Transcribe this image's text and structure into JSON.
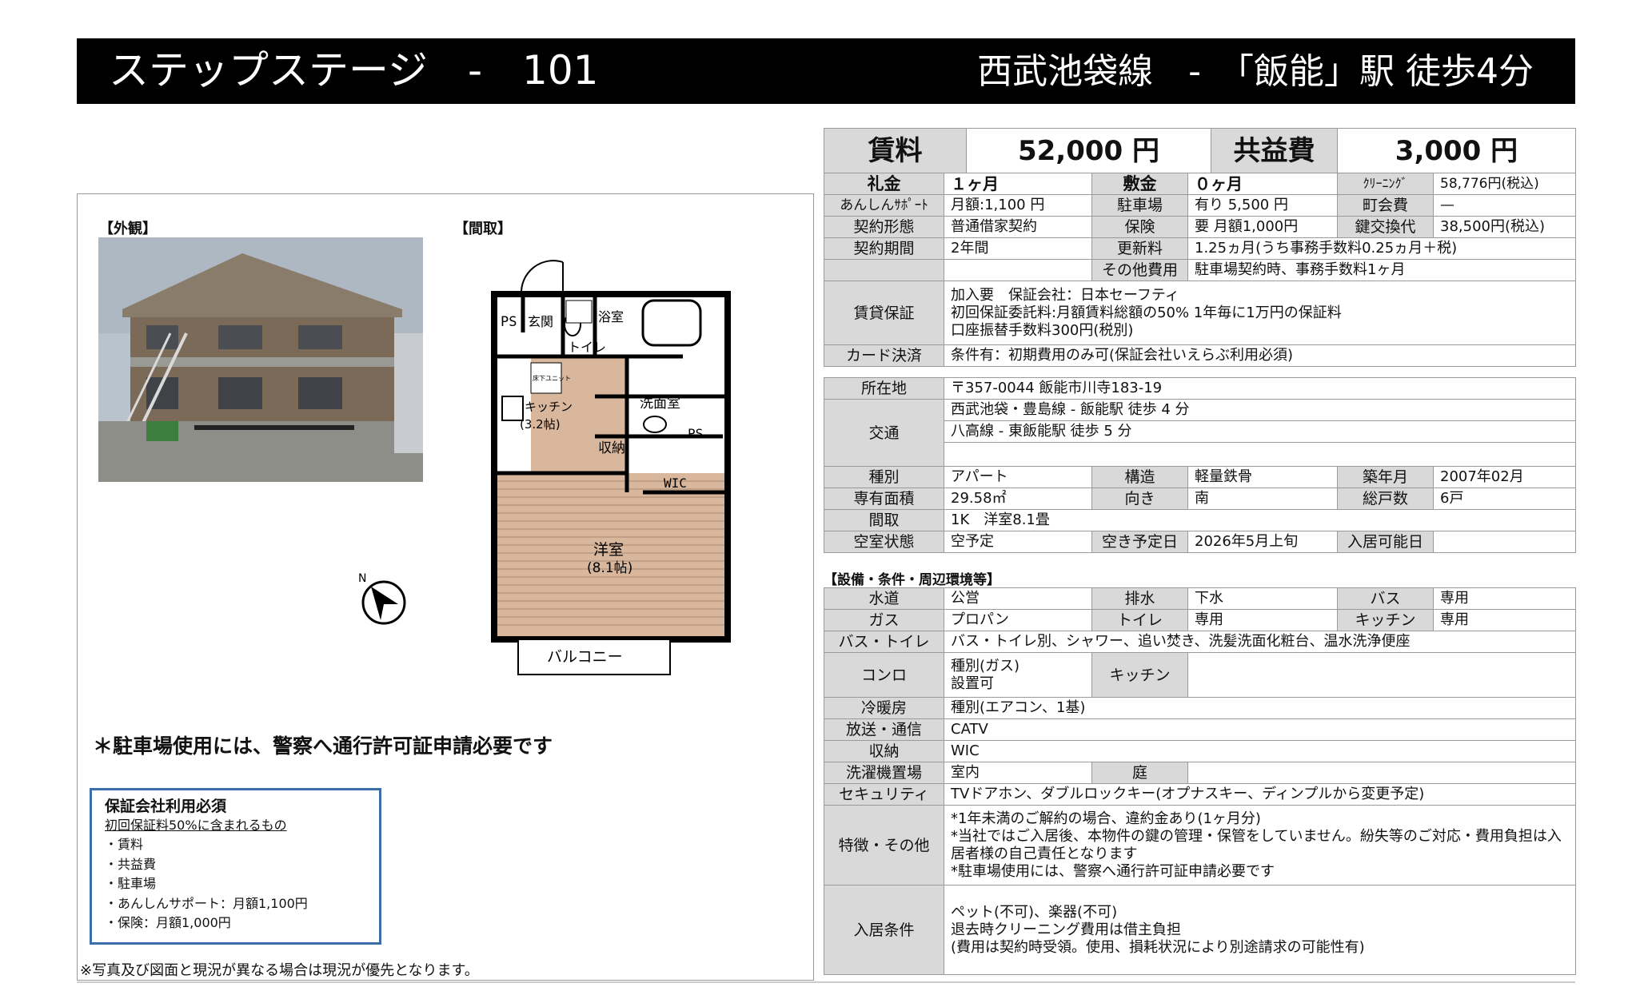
{
  "header": {
    "property": "ステップステージ　-　101",
    "station": "西武池袋線　-　「飯能」駅 徒歩4分"
  },
  "photos": {
    "exterior_label": "【外観】",
    "floorplan_label": "【間取】"
  },
  "floorplan": {
    "ps1": "PS",
    "genkan": "玄関",
    "toilet": "トイレ",
    "bath": "浴室",
    "unit": "床下ユニット",
    "kitchen": "キッチン",
    "kitchen_size": "(3.2帖)",
    "storage": "収納",
    "washroom": "洗面室",
    "ps2": "PS",
    "wic": "WIC",
    "room": "洋室",
    "room_size": "(8.1帖)",
    "balcony": "バルコニー"
  },
  "compass_label": "N",
  "parking_note": "＊駐車場使用には、警察へ通行許可証申請必要です",
  "guarantee_box": {
    "title": "保証会社利用必須",
    "subtitle": "初回保証料50%に含まれるもの",
    "items": [
      "・賃料",
      "・共益費",
      "・駐車場",
      "・あんしんサポート：月額1,100円",
      "・保険：月額1,000円"
    ]
  },
  "footer_note": "※写真及び図面と現況が異なる場合は現況が優先となります。",
  "rent": {
    "rent_label": "賃料",
    "rent": "52,000 円",
    "fee_label": "共益費",
    "fee": "3,000 円"
  },
  "terms": {
    "reikin_l": "礼金",
    "reikin": "１ヶ月",
    "shikikin_l": "敷金",
    "shikikin": "０ヶ月",
    "cleaning_l": "ｸﾘｰﾆﾝｸﾞ",
    "cleaning": "58,776円(税込)",
    "anshin_l": "あんしんｻﾎﾟｰﾄ",
    "anshin": "月額:1,100 円",
    "parking_l": "駐車場",
    "parking": "有り 5,500 円",
    "chokai_l": "町会費",
    "chokai": "—",
    "contract_l": "契約形態",
    "contract": "普通借家契約",
    "insurance_l": "保険",
    "insurance": "要 月額1,000円",
    "key_l": "鍵交換代",
    "key": "38,500円(税込)",
    "period_l": "契約期間",
    "period": "2年間",
    "renew_l": "更新料",
    "renew": "1.25ヵ月(うち事務手数料0.25ヵ月＋税)",
    "other_l": "その他費用",
    "other": "駐車場契約時、事務手数料1ヶ月",
    "guar_l": "賃貸保証",
    "guar1": "加入要　保証会社：日本セーフティ",
    "guar2": "初回保証委託料:月額賃料総額の50% 1年毎に1万円の保証料",
    "guar3": "口座振替手数料300円(税別)",
    "card_l": "カード決済",
    "card": "条件有：初期費用のみ可(保証会社いえらぶ利用必須)"
  },
  "info": {
    "addr_l": "所在地",
    "addr": "〒357-0044 飯能市川寺183-19",
    "access_l": "交通",
    "access1": "西武池袋・豊島線 - 飯能駅 徒歩 4 分",
    "access2": "八高線 - 東飯能駅 徒歩 5 分",
    "type_l": "種別",
    "type": "アパート",
    "struct_l": "構造",
    "struct": "軽量鉄骨",
    "built_l": "築年月",
    "built": "2007年02月",
    "area_l": "専有面積",
    "area": "29.58㎡",
    "dir_l": "向き",
    "dir": "南",
    "units_l": "総戸数",
    "units": "6戸",
    "layout_l": "間取",
    "layout": "1K　洋室8.1畳",
    "status_l": "空室状態",
    "status": "空予定",
    "avail_l": "空き予定日",
    "avail": "2026年5月上旬",
    "move_l": "入居可能日",
    "move": ""
  },
  "facilities_title": "【設備・条件・周辺環境等】",
  "facilities": {
    "water_l": "水道",
    "water": "公営",
    "drain_l": "排水",
    "drain": "下水",
    "bath_l": "バス",
    "bath": "専用",
    "gas_l": "ガス",
    "gas": "プロパン",
    "toilet_l": "トイレ",
    "toilet": "専用",
    "kitchen_l": "キッチン",
    "kitchen": "専用",
    "bt_l": "バス・トイレ",
    "bt": "バス・トイレ別、シャワー、追い焚き、洗髪洗面化粧台、温水洗浄便座",
    "stove_l": "コンロ",
    "stove1": "種別(ガス)",
    "stove2": "設置可",
    "kitchen2_l": "キッチン",
    "kitchen2": "",
    "ac_l": "冷暖房",
    "ac": "種別(エアコン、1基)",
    "tv_l": "放送・通信",
    "tv": "CATV",
    "storage_l": "収納",
    "storage": "WIC",
    "washer_l": "洗濯機置場",
    "washer": "室内",
    "garden_l": "庭",
    "garden": "",
    "sec_l": "セキュリティ",
    "sec": "TVドアホン、ダブルロックキー(オプナスキー、ディンプルから変更予定)",
    "feat_l": "特徴・その他",
    "feat1": "*1年未満のご解約の場合、違約金あり(1ヶ月分)",
    "feat2": "*当社ではご入居後、本物件の鍵の管理・保管をしていません。紛失等のご対応・費用負担は入居者様の自己責任となります",
    "feat3": "*駐車場使用には、警察へ通行許可証申請必要です",
    "cond_l": "入居条件",
    "cond1": "ペット(不可)、楽器(不可)",
    "cond2": "退去時クリーニング費用は借主負担",
    "cond3": "(費用は契約時受領。使用、損耗状況により別途請求の可能性有)"
  },
  "colors": {
    "header_bg": "#000000",
    "label_bg": "#d9d9d9",
    "guarantee_border": "#3c6faa",
    "floor_wood": "#d9b79d"
  }
}
